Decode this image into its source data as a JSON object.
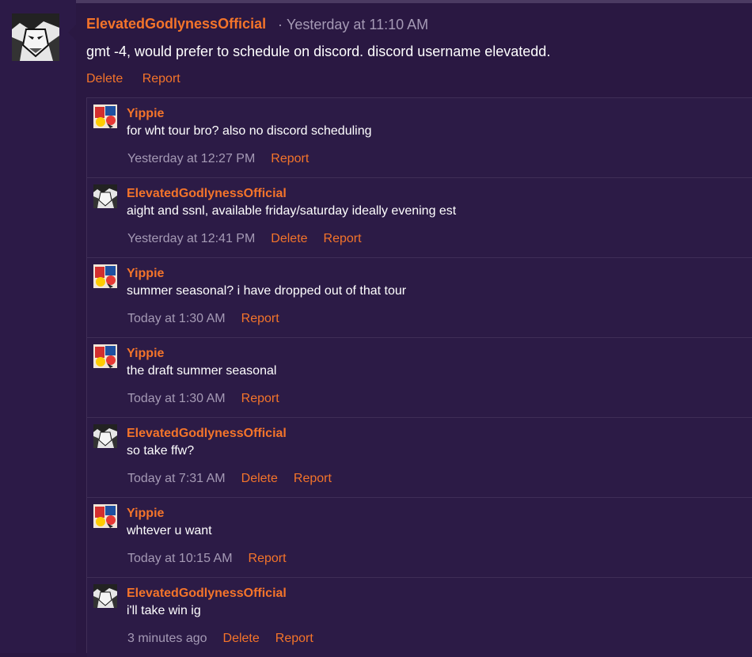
{
  "post": {
    "author": "ElevatedGodlynessOfficial",
    "separator": "·",
    "time": "Yesterday at 11:10 AM",
    "body": "gmt -4, would prefer to schedule on discord. discord username elevatedd.",
    "delete_label": "Delete",
    "report_label": "Report"
  },
  "comments": [
    {
      "author": "Yippie",
      "text": "for wht tour bro? also no discord scheduling",
      "time": "Yesterday at 12:27 PM",
      "delete_label": "",
      "report_label": "Report"
    },
    {
      "author": "ElevatedGodlynessOfficial",
      "text": "aight and ssnl, available friday/saturday ideally evening est",
      "time": "Yesterday at 12:41 PM",
      "delete_label": "Delete",
      "report_label": "Report"
    },
    {
      "author": "Yippie",
      "text": "summer seasonal? i have dropped out of that tour",
      "time": "Today at 1:30 AM",
      "delete_label": "",
      "report_label": "Report"
    },
    {
      "author": "Yippie",
      "text": "the draft summer seasonal",
      "time": "Today at 1:30 AM",
      "delete_label": "",
      "report_label": "Report"
    },
    {
      "author": "ElevatedGodlynessOfficial",
      "text": "so take ffw?",
      "time": "Today at 7:31 AM",
      "delete_label": "Delete",
      "report_label": "Report"
    },
    {
      "author": "Yippie",
      "text": "whtever u want",
      "time": "Today at 10:15 AM",
      "delete_label": "",
      "report_label": "Report"
    },
    {
      "author": "ElevatedGodlynessOfficial",
      "text": "i'll take win ig",
      "time": "3 minutes ago",
      "delete_label": "Delete",
      "report_label": "Report"
    }
  ]
}
